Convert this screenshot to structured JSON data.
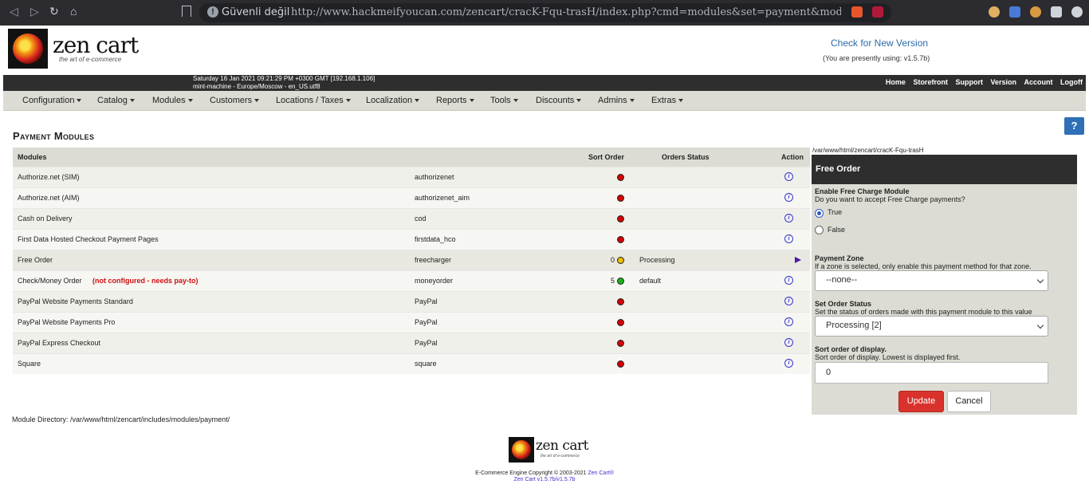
{
  "browser": {
    "insecure_label": "Güvenli değil",
    "url": "http://www.hackmeifyoucan.com/zencart/cracK-Fqu-trasH/index.php?cmd=modules&set=payment&module=freecharg..."
  },
  "header": {
    "brand": "zen cart",
    "tagline": "the art of e-commerce",
    "check_version": "Check for New Version",
    "using_version": "(You are presently using: v1.5.7b)",
    "info_line1": "Saturday 16 Jan 2021 09:21:29 PM +0300 GMT [192.168.1.106]",
    "info_line2": "mint-machine - Europe/Moscow - en_US.utf8",
    "links": [
      "Home",
      "Storefront",
      "Support",
      "Version",
      "Account",
      "Logoff"
    ]
  },
  "menu": [
    "Configuration",
    "Catalog",
    "Modules",
    "Customers",
    "Locations / Taxes",
    "Localization",
    "Reports",
    "Tools",
    "Discounts",
    "Admins",
    "Extras"
  ],
  "page": {
    "title": "Payment Modules",
    "help": "?",
    "module_dir": "Module Directory: /var/www/html/zencart/includes/modules/payment/"
  },
  "table": {
    "headers": {
      "modules": "Modules",
      "sort": "Sort Order",
      "status": "Orders Status",
      "action": "Action"
    },
    "rows": [
      {
        "name": "Authorize.net (SIM)",
        "note": "",
        "code": "authorizenet",
        "sort": "",
        "status": "",
        "dot": "#d40000"
      },
      {
        "name": "Authorize.net (AIM)",
        "note": "",
        "code": "authorizenet_aim",
        "sort": "",
        "status": "",
        "dot": "#d40000"
      },
      {
        "name": "Cash on Delivery",
        "note": "",
        "code": "cod",
        "sort": "",
        "status": "",
        "dot": "#d40000"
      },
      {
        "name": "First Data Hosted Checkout Payment Pages",
        "note": "",
        "code": "firstdata_hco",
        "sort": "",
        "status": "",
        "dot": "#d40000"
      },
      {
        "name": "Free Order",
        "note": "",
        "code": "freecharger",
        "sort": "0",
        "status": "Processing",
        "dot": "#e8c000"
      },
      {
        "name": "Check/Money Order",
        "note": "(not configured - needs pay-to)",
        "code": "moneyorder",
        "sort": "5",
        "status": "default",
        "dot": "#16b316"
      },
      {
        "name": "PayPal Website Payments Standard",
        "note": "",
        "code": "PayPal",
        "sort": "",
        "status": "",
        "dot": "#d40000"
      },
      {
        "name": "PayPal Website Payments Pro",
        "note": "",
        "code": "PayPal",
        "sort": "",
        "status": "",
        "dot": "#d40000"
      },
      {
        "name": "PayPal Express Checkout",
        "note": "",
        "code": "PayPal",
        "sort": "",
        "status": "",
        "dot": "#d40000"
      },
      {
        "name": "Square",
        "note": "",
        "code": "square",
        "sort": "",
        "status": "",
        "dot": "#d40000"
      }
    ]
  },
  "panel": {
    "path": "/var/www/html/zencart/cracK-Fqu-trasH",
    "title": "Free Order",
    "enable_label": "Enable Free Charge Module",
    "enable_desc": "Do you want to accept Free Charge payments?",
    "opt_true": "True",
    "opt_false": "False",
    "zone_label": "Payment Zone",
    "zone_desc": "If a zone is selected, only enable this payment method for that zone.",
    "zone_value": "--none--",
    "status_label": "Set Order Status",
    "status_desc": "Set the status of orders made with this payment module to this value",
    "status_value": "Processing [2]",
    "sort_label": "Sort order of display.",
    "sort_desc": "Sort order of display. Lowest is displayed first.",
    "sort_value": "0",
    "update": "Update",
    "cancel": "Cancel"
  },
  "footer": {
    "brand": "zen cart",
    "tagline": "the art of e-commerce",
    "copyright": "E-Commerce Engine Copyright © 2003-2021",
    "copyright_link": "Zen Cart®",
    "version": "Zen Cart v1.5.7b/v1.5.7b"
  }
}
